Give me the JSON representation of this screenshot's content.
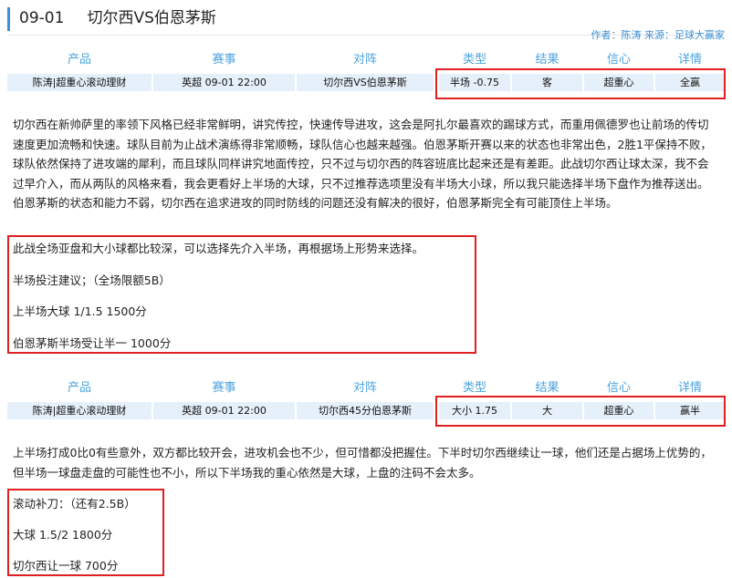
{
  "title": {
    "date": "09-01",
    "match": "切尔西VS伯恩茅斯"
  },
  "byline": "作者：陈涛 来源：足球大赢家",
  "table_headers": [
    "产品",
    "赛事",
    "对阵",
    "类型",
    "结果",
    "信心",
    "详情"
  ],
  "pick1": {
    "product": "陈涛|超重心滚动理财",
    "event": "英超 09-01 22:00",
    "matchup": "切尔西VS伯恩茅斯",
    "type": "半场 -0.75",
    "result": "客",
    "confidence": "超重心",
    "detail": "全赢"
  },
  "analysis1": "切尔西在新帅萨里的率领下风格已经非常鲜明，讲究传控，快速传导进攻，这会是阿扎尔最喜欢的踢球方式，而重用佩德罗也让前场的传切速度更加流畅和快速。球队目前为止战术演练得非常顺畅，球队信心也越来越强。伯恩茅斯开赛以来的状态也非常出色，2胜1平保持不败，球队依然保持了进攻端的犀利，而且球队同样讲究地面传控，只不过与切尔西的阵容班底比起来还是有差距。此战切尔西让球太深，我不会过早介入，而从两队的风格来看，我会更看好上半场的大球，只不过推荐选项里没有半场大小球，所以我只能选择半场下盘作为推荐送出。伯恩茅斯的状态和能力不弱，切尔西在追求进攻的同时防线的问题还没有解决的很好，伯恩茅斯完全有可能顶住上半场。",
  "tips1": [
    "此战全场亚盘和大小球都比较深，可以选择先介入半场，再根据场上形势来选择。",
    "半场投注建议；（全场限额5B）",
    "上半场大球   1/1.5    1500分",
    "伯恩茅斯半场受让半一     1000分"
  ],
  "pick2": {
    "product": "陈涛|超重心滚动理财",
    "event": "英超 09-01 22:00",
    "matchup": "切尔西45分伯恩茅斯",
    "type": "大小 1.75",
    "result": "大",
    "confidence": "超重心",
    "detail": "赢半"
  },
  "analysis2": "上半场打成0比0有些意外，双方都比较开会，进攻机会也不少，但可惜都没把握住。下半时切尔西继续让一球，他们还是占据场上优势的，但半场一球盘走盘的可能性也不小，所以下半场我的重心依然是大球，上盘的注码不会太多。",
  "tips2": [
    "滚动补刀：（还有2.5B）",
    "大球    1.5/2    1800分",
    "切尔西让一球     700分"
  ]
}
